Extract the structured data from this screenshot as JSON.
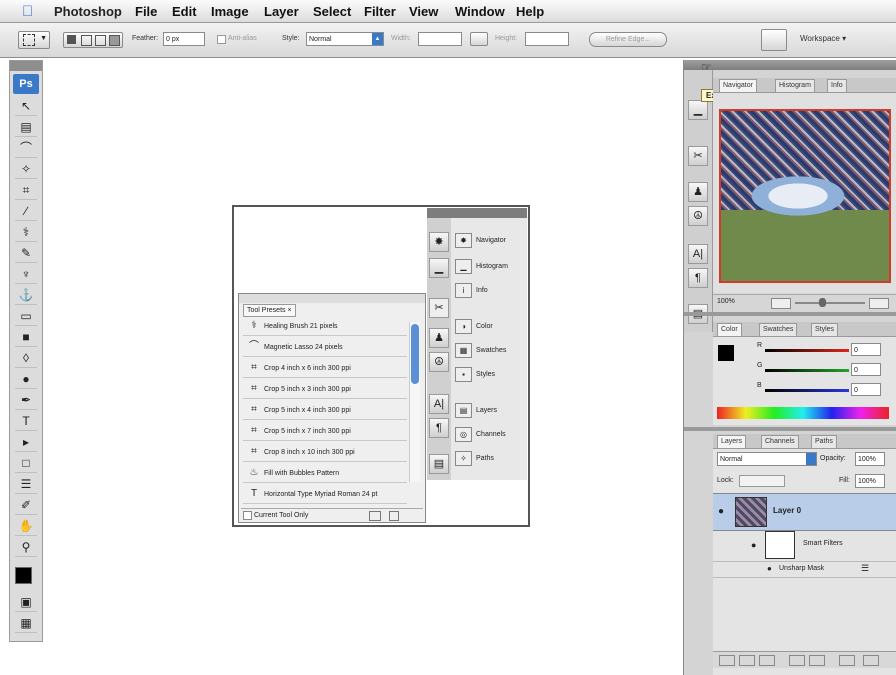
{
  "menubar": {
    "app_name": "Photoshop",
    "items": [
      "File",
      "Edit",
      "Image",
      "Layer",
      "Select",
      "Filter",
      "View",
      "Window",
      "Help"
    ]
  },
  "options": {
    "feather_label": "Feather:",
    "feather_value": "0 px",
    "antialias_label": "Anti-alias",
    "style_label": "Style:",
    "style_value": "Normal",
    "width_label": "Width:",
    "height_label": "Height:",
    "refine_edges": "Refine Edge...",
    "workspace": "Workspace ▾"
  },
  "toolbar": {
    "logo": "Ps",
    "tool_icons": [
      "move-tool-icon",
      "marquee-tool-icon",
      "lasso-tool-icon",
      "magic-wand-icon",
      "crop-tool-icon",
      "slice-tool-icon",
      "healing-brush-icon",
      "brush-tool-icon",
      "stamp-tool-icon",
      "history-brush-icon",
      "eraser-icon",
      "gradient-tool-icon",
      "blur-tool-icon",
      "dodge-tool-icon",
      "pen-tool-icon",
      "type-tool-icon",
      "path-select-icon",
      "shape-tool-icon",
      "notes-tool-icon",
      "eyedropper-icon",
      "hand-tool-icon",
      "zoom-tool-icon"
    ],
    "tool_glyphs": [
      "↖",
      "▤",
      "⌒",
      "✧",
      "⌗",
      "∕",
      "⚕",
      "✎",
      "♆",
      "⚓",
      "▭",
      "■",
      "◊",
      "●",
      "✒",
      "T",
      "▸",
      "□",
      "☰",
      "✐",
      "✋",
      "⚲"
    ]
  },
  "dock": {
    "tooltip": "Expand Dock",
    "navigator_tabs": [
      "Navigator",
      "Histogram",
      "Info"
    ],
    "zoom_value": "100%",
    "color_tabs": [
      "Color",
      "Swatches",
      "Styles"
    ],
    "color_labels": [
      "R",
      "G",
      "B"
    ],
    "color_values": [
      "0",
      "0",
      "0"
    ],
    "layers_tabs": [
      "Layers",
      "Channels",
      "Paths"
    ],
    "blend_mode": "Normal",
    "opacity_label": "Opacity:",
    "opacity_value": "100%",
    "lock_label": "Lock:",
    "fill_label": "Fill:",
    "fill_value": "100%",
    "layer_name": "Layer 0",
    "smart_filters": "Smart Filters",
    "filter_name": "Unsharp Mask"
  },
  "figure": {
    "panel_rows": [
      {
        "icon": "navigator-icon",
        "glyph": "✸",
        "label": "Navigator"
      },
      {
        "icon": "histogram-icon",
        "glyph": "▁",
        "label": "Histogram"
      },
      {
        "icon": "info-icon",
        "glyph": "i",
        "label": "Info"
      },
      {
        "icon": "color-icon",
        "glyph": "◑",
        "label": "Color"
      },
      {
        "icon": "swatches-icon",
        "glyph": "▦",
        "label": "Swatches"
      },
      {
        "icon": "styles-icon",
        "glyph": "▪",
        "label": "Styles"
      },
      {
        "icon": "layers-icon",
        "glyph": "▤",
        "label": "Layers"
      },
      {
        "icon": "channels-icon",
        "glyph": "◎",
        "label": "Channels"
      },
      {
        "icon": "paths-icon",
        "glyph": "✧",
        "label": "Paths"
      }
    ],
    "tool_presets_tab": "Tool Presets",
    "presets": [
      {
        "icon": "healing-brush-icon",
        "glyph": "⚕",
        "label": "Healing Brush 21 pixels"
      },
      {
        "icon": "magnetic-lasso-icon",
        "glyph": "⌒",
        "label": "Magnetic Lasso 24 pixels"
      },
      {
        "icon": "crop-tool-icon",
        "glyph": "⌗",
        "label": "Crop 4 inch x 6 inch 300 ppi"
      },
      {
        "icon": "crop-tool-icon",
        "glyph": "⌗",
        "label": "Crop 5 inch x 3 inch 300 ppi"
      },
      {
        "icon": "crop-tool-icon",
        "glyph": "⌗",
        "label": "Crop 5 inch x 4 inch 300 ppi"
      },
      {
        "icon": "crop-tool-icon",
        "glyph": "⌗",
        "label": "Crop 5 inch x 7 inch 300 ppi"
      },
      {
        "icon": "crop-tool-icon",
        "glyph": "⌗",
        "label": "Crop 8 inch x 10 inch 300 ppi"
      },
      {
        "icon": "paint-bucket-icon",
        "glyph": "♨",
        "label": "Fill with Bubbles Pattern"
      },
      {
        "icon": "type-tool-icon",
        "glyph": "T",
        "label": "Horizontal Type Myriad Roman 24 pt"
      }
    ],
    "current_tool_only": "Current Tool Only"
  },
  "colors": {
    "accent": "#3a78c8",
    "tooltip_bg": "#fff6c8",
    "selected_layer": "#b9cde8"
  }
}
